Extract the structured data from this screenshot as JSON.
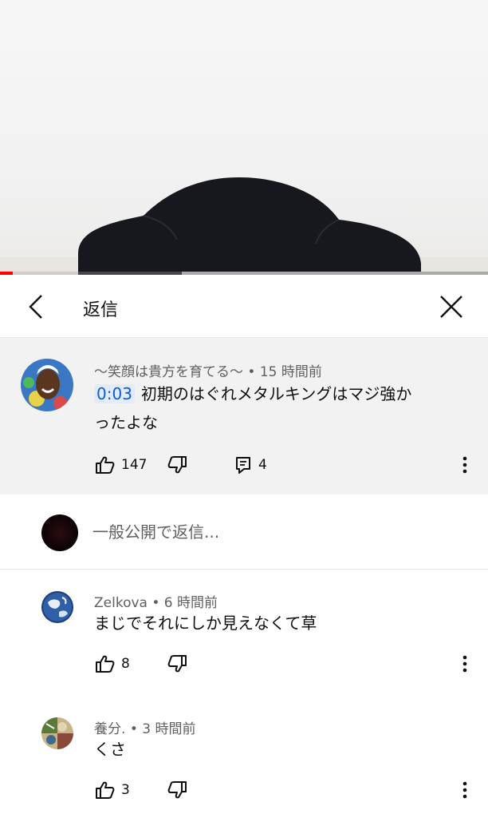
{
  "video": {
    "progress_played_fraction": 0.026
  },
  "panel": {
    "title": "返信",
    "back_icon": "chevron-left-icon",
    "close_icon": "close-icon"
  },
  "parent_comment": {
    "author": "〜笑顔は貴方を育てる〜",
    "separator": "•",
    "time": "15 時間前",
    "timestamp_link": "0:03",
    "text_line1": "初期のはぐれメタルキングはマジ強か",
    "text_line2": "ったよな",
    "likes": "147",
    "replies": "4",
    "icons": [
      "like-icon",
      "dislike-icon",
      "reply-icon",
      "more-vert-icon"
    ]
  },
  "reply_box": {
    "placeholder": "一般公開で返信..."
  },
  "replies": [
    {
      "author": "Zelkova",
      "separator": "•",
      "time": "6 時間前",
      "text": "まじでそれにしか見えなくて草",
      "likes": "8"
    },
    {
      "author": "養分.",
      "separator": "•",
      "time": "3 時間前",
      "text": "くさ",
      "likes": "3"
    }
  ],
  "colors": {
    "accent_link": "#065fd4",
    "progress": "#ff0000",
    "parent_bg": "#f2f2f2"
  }
}
